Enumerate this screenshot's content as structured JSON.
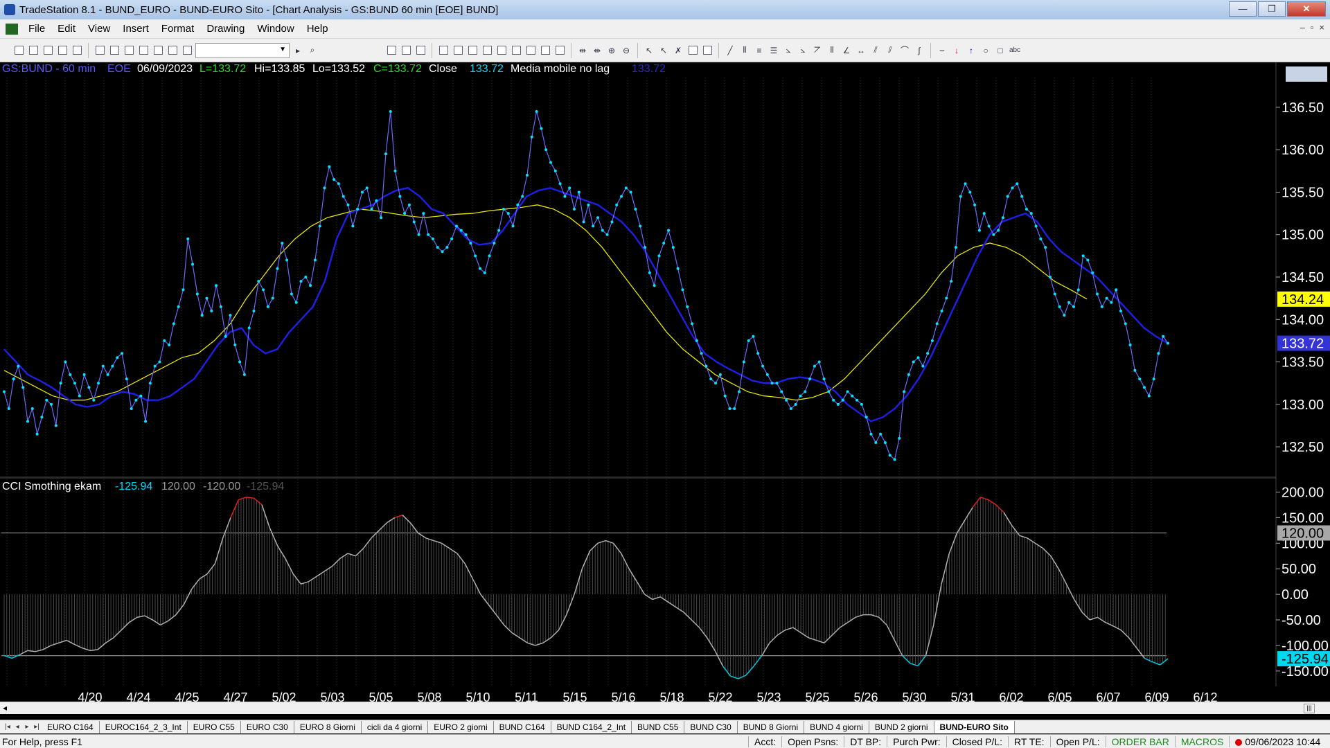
{
  "window": {
    "title": "TradeStation 8.1 - BUND_EURO - BUND-EURO Sito - [Chart Analysis - GS:BUND  60 min  [EOE] BUND]",
    "buttons": [
      "—",
      "❐",
      "✕"
    ]
  },
  "menu": {
    "items": [
      "File",
      "Edit",
      "View",
      "Insert",
      "Format",
      "Drawing",
      "Window",
      "Help"
    ],
    "mdi": [
      "–",
      "▫",
      "×"
    ]
  },
  "header": {
    "symbol": "GS:BUND - 60 min",
    "exchange": "EOE",
    "date": "06/09/2023",
    "low_label": "L=133.72",
    "high_label": "Hi=133.85",
    "lo_label": "Lo=133.52",
    "close_label": "C=133.72",
    "close_name": "Close",
    "close_value": "133.72",
    "ma_name": "Media mobile no lag",
    "ma_value": "133.72"
  },
  "cci_header": {
    "name": "CCI Smothing ekam",
    "v1": "-125.94",
    "v2": "120.00",
    "v3": "-120.00",
    "v4": "-125.94"
  },
  "colors": {
    "price": "#6a6aff",
    "price_dots": "#00e5ff",
    "ma_blue": "#1f1fe8",
    "ma_yellow": "#e8e800",
    "cci_line": "#b0b0b0",
    "cci_high": "#e02020",
    "cci_low": "#00c8e0"
  },
  "price_axis": {
    "ticks": [
      "136.50",
      "136.00",
      "135.50",
      "135.00",
      "134.50",
      "134.00",
      "133.50",
      "133.00",
      "132.50"
    ],
    "tick_values": [
      136.5,
      136.0,
      135.5,
      135.0,
      134.5,
      134.0,
      133.5,
      133.0,
      132.5
    ],
    "marker_yellow": "134.24",
    "marker_yellow_value": 134.24,
    "marker_blue": "133.72",
    "marker_blue_value": 133.72
  },
  "cci_axis": {
    "ticks": [
      "200.00",
      "150.00",
      "100.00",
      "50.00",
      "0.00",
      "-50.00",
      "-100.00",
      "-150.00"
    ],
    "tick_values": [
      200,
      150,
      100,
      50,
      0,
      -50,
      -100,
      -150
    ],
    "marker_upper": "120.00",
    "marker_upper_value": 120,
    "marker_current": "-125.94",
    "marker_current_value": -125.94
  },
  "time_axis": [
    "4/20",
    "4/24",
    "4/25",
    "4/27",
    "5/02",
    "5/03",
    "5/05",
    "5/08",
    "5/10",
    "5/11",
    "5/15",
    "5/16",
    "5/18",
    "5/22",
    "5/23",
    "5/25",
    "5/26",
    "5/30",
    "5/31",
    "6/02",
    "6/05",
    "6/07",
    "6/09",
    "6/12"
  ],
  "chart_data": {
    "type": "line",
    "price_series": {
      "name": "Close",
      "values": [
        133.15,
        132.95,
        133.3,
        133.45,
        133.2,
        132.8,
        132.95,
        132.65,
        132.85,
        133.05,
        133.0,
        132.75,
        133.25,
        133.5,
        133.35,
        133.25,
        133.1,
        133.35,
        133.2,
        133.05,
        133.25,
        133.45,
        133.35,
        133.45,
        133.55,
        133.6,
        133.3,
        132.95,
        133.05,
        133.1,
        132.8,
        133.25,
        133.45,
        133.5,
        133.75,
        133.7,
        133.95,
        134.15,
        134.35,
        134.95,
        134.65,
        134.3,
        134.05,
        134.25,
        134.1,
        134.4,
        134.15,
        133.8,
        134.05,
        133.7,
        133.5,
        133.35,
        133.9,
        134.1,
        134.45,
        134.35,
        134.15,
        134.25,
        134.6,
        134.9,
        134.7,
        134.3,
        134.2,
        134.45,
        134.5,
        134.4,
        134.7,
        135.1,
        135.55,
        135.8,
        135.65,
        135.6,
        135.45,
        135.35,
        135.1,
        135.3,
        135.5,
        135.55,
        135.3,
        135.4,
        135.2,
        135.95,
        136.45,
        135.75,
        135.45,
        135.25,
        135.35,
        135.15,
        135.0,
        135.25,
        135.0,
        134.95,
        134.85,
        134.8,
        134.85,
        134.95,
        135.1,
        135.05,
        135.0,
        134.9,
        134.75,
        134.6,
        134.55,
        134.75,
        134.9,
        135.05,
        135.3,
        135.25,
        135.1,
        135.35,
        135.45,
        135.7,
        136.15,
        136.45,
        136.25,
        136.0,
        135.85,
        135.75,
        135.6,
        135.45,
        135.55,
        135.3,
        135.5,
        135.15,
        135.35,
        135.1,
        135.2,
        135.05,
        135.0,
        135.15,
        135.35,
        135.45,
        135.55,
        135.5,
        135.3,
        135.1,
        134.85,
        134.55,
        134.4,
        134.75,
        134.9,
        135.05,
        134.85,
        134.6,
        134.35,
        134.15,
        133.95,
        133.75,
        133.6,
        133.45,
        133.3,
        133.25,
        133.35,
        133.1,
        132.95,
        132.95,
        133.15,
        133.5,
        133.75,
        133.8,
        133.6,
        133.45,
        133.35,
        133.25,
        133.25,
        133.15,
        133.05,
        132.95,
        133.0,
        133.1,
        133.15,
        133.3,
        133.45,
        133.5,
        133.3,
        133.15,
        133.05,
        133.0,
        133.05,
        133.15,
        133.1,
        133.05,
        133.0,
        132.85,
        132.65,
        132.55,
        132.65,
        132.55,
        132.4,
        132.35,
        132.6,
        133.15,
        133.35,
        133.5,
        133.55,
        133.45,
        133.6,
        133.75,
        133.95,
        134.1,
        134.25,
        134.45,
        134.85,
        135.45,
        135.6,
        135.5,
        135.35,
        135.05,
        135.25,
        135.1,
        135.0,
        135.05,
        135.2,
        135.45,
        135.55,
        135.6,
        135.45,
        135.3,
        135.25,
        135.1,
        134.95,
        134.85,
        134.5,
        134.3,
        134.15,
        134.05,
        134.2,
        134.15,
        134.35,
        134.75,
        134.7,
        134.55,
        134.3,
        134.15,
        134.25,
        134.2,
        134.35,
        134.1,
        133.95,
        133.7,
        133.4,
        133.3,
        133.2,
        133.1,
        133.3,
        133.6,
        133.8,
        133.72
      ]
    },
    "ma_blue": {
      "name": "Media mobile no lag",
      "values": [
        133.65,
        133.5,
        133.35,
        133.28,
        133.2,
        133.1,
        133.0,
        132.97,
        133.0,
        133.1,
        133.15,
        133.12,
        133.05,
        133.05,
        133.1,
        133.2,
        133.3,
        133.5,
        133.7,
        133.85,
        133.9,
        133.7,
        133.6,
        133.65,
        133.85,
        134.0,
        134.15,
        134.45,
        134.95,
        135.25,
        135.3,
        135.35,
        135.45,
        135.52,
        135.55,
        135.45,
        135.3,
        135.25,
        135.1,
        134.95,
        134.88,
        134.9,
        135.05,
        135.25,
        135.45,
        135.52,
        135.55,
        135.5,
        135.45,
        135.4,
        135.35,
        135.25,
        135.15,
        135.0,
        134.8,
        134.55,
        134.3,
        134.05,
        133.8,
        133.6,
        133.5,
        133.42,
        133.35,
        133.28,
        133.25,
        133.25,
        133.3,
        133.32,
        133.3,
        133.25,
        133.15,
        133.0,
        132.9,
        132.8,
        132.85,
        132.95,
        133.1,
        133.3,
        133.55,
        133.85,
        134.15,
        134.45,
        134.75,
        135.0,
        135.15,
        135.2,
        135.25,
        135.15,
        134.95,
        134.8,
        134.7,
        134.6,
        134.5,
        134.35,
        134.2,
        134.05,
        133.9,
        133.8,
        133.72
      ]
    },
    "ma_yellow": {
      "values": [
        133.4,
        133.3,
        133.2,
        133.1,
        133.05,
        133.05,
        133.1,
        133.15,
        133.25,
        133.35,
        133.45,
        133.55,
        133.6,
        133.75,
        133.95,
        134.25,
        134.5,
        134.75,
        134.95,
        135.1,
        135.2,
        135.25,
        135.3,
        135.28,
        135.25,
        135.22,
        135.2,
        135.22,
        135.24,
        135.25,
        135.28,
        135.3,
        135.32,
        135.35,
        135.3,
        135.2,
        135.05,
        134.85,
        134.6,
        134.35,
        134.1,
        133.85,
        133.65,
        133.5,
        133.35,
        133.25,
        133.15,
        133.1,
        133.08,
        133.05,
        133.08,
        133.15,
        133.3,
        133.5,
        133.7,
        133.9,
        134.1,
        134.3,
        134.55,
        134.75,
        134.85,
        134.9,
        134.85,
        134.75,
        134.6,
        134.45,
        134.35,
        134.24
      ]
    },
    "cci_series": {
      "name": "CCI Smothing ekam",
      "values": [
        -120,
        -125,
        -118,
        -110,
        -112,
        -108,
        -100,
        -95,
        -90,
        -98,
        -105,
        -110,
        -108,
        -95,
        -85,
        -70,
        -55,
        -45,
        -42,
        -50,
        -60,
        -52,
        -40,
        -20,
        10,
        30,
        40,
        60,
        110,
        150,
        185,
        190,
        188,
        175,
        130,
        95,
        70,
        40,
        20,
        25,
        35,
        45,
        55,
        70,
        80,
        75,
        90,
        110,
        125,
        140,
        150,
        155,
        140,
        120,
        110,
        105,
        100,
        90,
        80,
        60,
        30,
        0,
        -20,
        -40,
        -60,
        -75,
        -85,
        -95,
        -100,
        -95,
        -85,
        -70,
        -40,
        0,
        50,
        85,
        100,
        105,
        100,
        80,
        50,
        25,
        0,
        -10,
        -5,
        -15,
        -25,
        -35,
        -50,
        -65,
        -85,
        -110,
        -140,
        -160,
        -165,
        -158,
        -140,
        -120,
        -95,
        -80,
        -70,
        -65,
        -75,
        -85,
        -90,
        -95,
        -80,
        -65,
        -55,
        -45,
        -40,
        -40,
        -45,
        -60,
        -90,
        -120,
        -135,
        -140,
        -120,
        -60,
        20,
        80,
        120,
        145,
        170,
        190,
        185,
        175,
        160,
        135,
        115,
        110,
        100,
        90,
        75,
        50,
        20,
        -10,
        -35,
        -50,
        -45,
        -55,
        -62,
        -70,
        -85,
        -105,
        -125,
        -132,
        -138,
        -125.94
      ]
    },
    "price_ylim": [
      132.15,
      136.85
    ],
    "cci_ylim": [
      -180,
      225
    ],
    "cci_upper_band": 120,
    "cci_lower_band": -120
  },
  "scroll": {
    "left": "◂",
    "right": "|||"
  },
  "tabs": [
    "EURO C164",
    "EUROC164_2_3_Int",
    "EURO C55",
    "EURO C30",
    "EURO 8 Giorni",
    "cicli da 4 giorni",
    "EURO 2 giorni",
    "BUND C164",
    "BUND C164_2_Int",
    "BUND C55",
    "BUND  C30",
    "BUND 8 Giorni",
    "BUND 4 giorni",
    "BUND 2 giorni",
    "BUND-EURO Sito"
  ],
  "tab_nav": [
    "|◂",
    "◂",
    "▸",
    "▸|"
  ],
  "status": {
    "help": "For Help, press F1",
    "fields": [
      "Acct:",
      "Open Psns:",
      "DT BP:",
      "Purch Pwr:",
      "Closed P/L:",
      "RT TE:",
      "Open P/L:"
    ],
    "order_bar": "ORDER BAR",
    "macros": "MACROS",
    "datetime": "09/06/2023 10:44"
  }
}
